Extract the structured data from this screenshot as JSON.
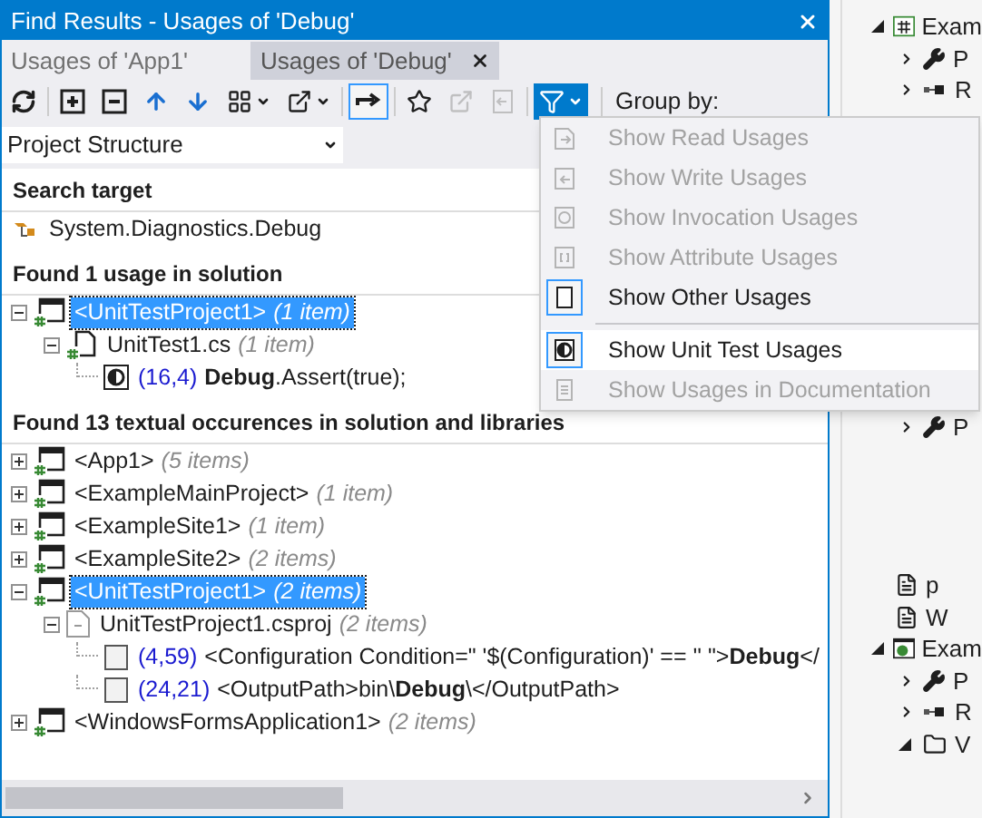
{
  "window": {
    "title": "Find Results - Usages of 'Debug'"
  },
  "tabs": [
    {
      "label": "Usages of 'App1'",
      "selected": false
    },
    {
      "label": "Usages of 'Debug'",
      "selected": true
    }
  ],
  "toolbar": {
    "buttons": [
      {
        "kind": "refresh"
      },
      {
        "kind": "expand-all"
      },
      {
        "kind": "collapse-all"
      },
      {
        "kind": "up"
      },
      {
        "kind": "down"
      },
      {
        "kind": "grid-menu"
      },
      {
        "kind": "export-menu"
      },
      {
        "kind": "merge",
        "pressed": true
      },
      {
        "kind": "pin"
      },
      {
        "kind": "export-doc",
        "disabled": true
      },
      {
        "kind": "back",
        "disabled": true
      },
      {
        "kind": "filter",
        "open": true
      }
    ],
    "group_by_label": "Group by:"
  },
  "grouping": {
    "value": "Project Structure"
  },
  "sections": [
    {
      "title": "Search target",
      "nodes": [
        {
          "kind": "class",
          "name": "System.Diagnostics.Debug"
        }
      ]
    },
    {
      "title": "Found 1 usage in solution",
      "nodes": [
        {
          "kind": "project",
          "name": "<UnitTestProject1>",
          "count": "(1 item)",
          "selected": true,
          "expanded": true,
          "children": [
            {
              "kind": "csfile",
              "name": "UnitTest1.cs",
              "count": "(1 item)",
              "selected": false,
              "expanded": true,
              "children": [
                {
                  "kind": "test",
                  "position": "(16,4)",
                  "name": "**Debug**.Assert(true);"
                }
              ]
            }
          ]
        }
      ]
    },
    {
      "title": "Found 13 textual occurences in solution and libraries",
      "nodes": [
        {
          "kind": "project",
          "name": "<App1>",
          "count": "(5 items)",
          "selected": false,
          "expanded": false
        },
        {
          "kind": "project",
          "name": "<ExampleMainProject>",
          "count": "(1 item)",
          "selected": false,
          "expanded": false
        },
        {
          "kind": "project",
          "name": "<ExampleSite1>",
          "count": "(1 item)",
          "selected": false,
          "expanded": false
        },
        {
          "kind": "project",
          "name": "<ExampleSite2>",
          "count": "(2 items)",
          "selected": false,
          "expanded": false
        },
        {
          "kind": "project",
          "name": "<UnitTestProject1>",
          "count": "(2 items)",
          "selected": true,
          "expanded": true,
          "children": [
            {
              "kind": "projfile",
              "name": "UnitTestProject1.csproj",
              "count": "(2 items)",
              "selected": false,
              "expanded": true,
              "children": [
                {
                  "kind": "text",
                  "position": "(4,59)",
                  "name": "<Configuration Condition=\" '$(Configuration)' == '' \">**Debug**</"
                },
                {
                  "kind": "text",
                  "position": "(24,21)",
                  "name": "<OutputPath>bin\\**Debug**\\</OutputPath>"
                }
              ]
            }
          ]
        },
        {
          "kind": "project",
          "name": "<WindowsFormsApplication1>",
          "count": "(2 items)",
          "selected": false,
          "expanded": false
        }
      ]
    }
  ],
  "filter_menu": {
    "items": [
      {
        "kind": "read",
        "label": "Show Read Usages",
        "disabled": true,
        "checked": false,
        "highlighted": false
      },
      {
        "kind": "write",
        "label": "Show Write Usages",
        "disabled": true,
        "checked": false,
        "highlighted": false
      },
      {
        "kind": "invocation",
        "label": "Show Invocation Usages",
        "disabled": true,
        "checked": false,
        "highlighted": false
      },
      {
        "kind": "attribute",
        "label": "Show Attribute Usages",
        "disabled": true,
        "checked": false,
        "highlighted": false
      },
      {
        "kind": "other",
        "label": "Show Other Usages",
        "disabled": false,
        "checked": true,
        "highlighted": false
      },
      {
        "kind": "unit-test",
        "label": "Show Unit Test Usages",
        "disabled": false,
        "checked": true,
        "highlighted": true,
        "separator_before": true
      },
      {
        "kind": "documentation",
        "label": "Show Usages in Documentation",
        "disabled": true,
        "checked": false,
        "highlighted": false
      }
    ]
  },
  "solution_explorer": {
    "top_rows": [
      {
        "kind": "csharp-project",
        "name": "Exam",
        "expanded": true,
        "children": [
          {
            "kind": "properties",
            "name": "P",
            "expanded": false
          },
          {
            "kind": "references",
            "name": "R",
            "expanded": false
          }
        ]
      }
    ],
    "bottom_rows": [
      {
        "kind": "properties",
        "name": "P",
        "expanded": false
      }
    ],
    "lower_rows": [
      {
        "kind": "file",
        "name": "p"
      },
      {
        "kind": "file",
        "name": "W"
      },
      {
        "kind": "web-project",
        "name": "Exam",
        "expanded": true,
        "children": [
          {
            "kind": "properties",
            "name": "P",
            "expanded": false
          },
          {
            "kind": "references",
            "name": "R",
            "expanded": false
          },
          {
            "kind": "folder",
            "name": "V",
            "expanded": true
          }
        ]
      }
    ]
  }
}
